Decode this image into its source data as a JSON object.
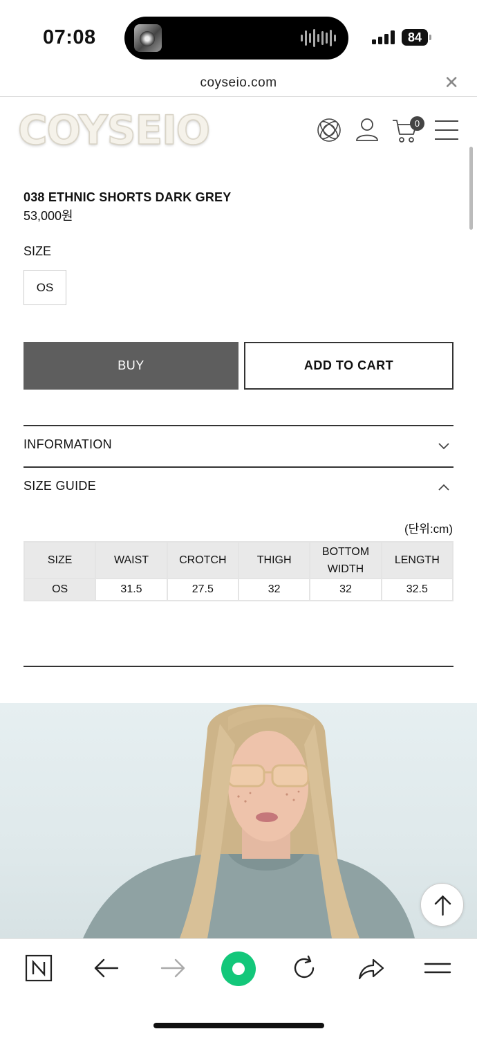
{
  "status_bar": {
    "time": "07:08",
    "battery": "84"
  },
  "browser": {
    "url": "coyseio.com",
    "close_icon": "close-icon"
  },
  "site": {
    "logo_text": "COYSEIO",
    "header_icons": [
      "globe-icon",
      "user-icon",
      "cart-icon",
      "menu-icon"
    ],
    "cart_count": "0"
  },
  "product": {
    "title": "038 ETHNIC SHORTS DARK GREY",
    "price": "53,000원",
    "size_label": "SIZE",
    "size_options": [
      "OS"
    ],
    "buy_label": "BUY",
    "add_to_cart_label": "ADD TO CART"
  },
  "accordion": {
    "information_label": "INFORMATION",
    "information_state": "collapsed",
    "size_guide_label": "SIZE GUIDE",
    "size_guide_state": "expanded"
  },
  "size_guide": {
    "unit": "(단위:cm)",
    "headers": [
      "SIZE",
      "WAIST",
      "CROTCH",
      "THIGH",
      "BOTTOM WIDTH",
      "LENGTH"
    ],
    "rows": [
      [
        "OS",
        "31.5",
        "27.5",
        "32",
        "32",
        "32.5"
      ]
    ]
  },
  "colors": {
    "buy_button": "#5e5e5e",
    "table_header": "#e9e9e9"
  },
  "toolbar": {
    "items": [
      "naver-icon",
      "back-icon",
      "forward-icon",
      "green-dot-icon",
      "reload-icon",
      "share-icon",
      "menu-icon"
    ]
  }
}
